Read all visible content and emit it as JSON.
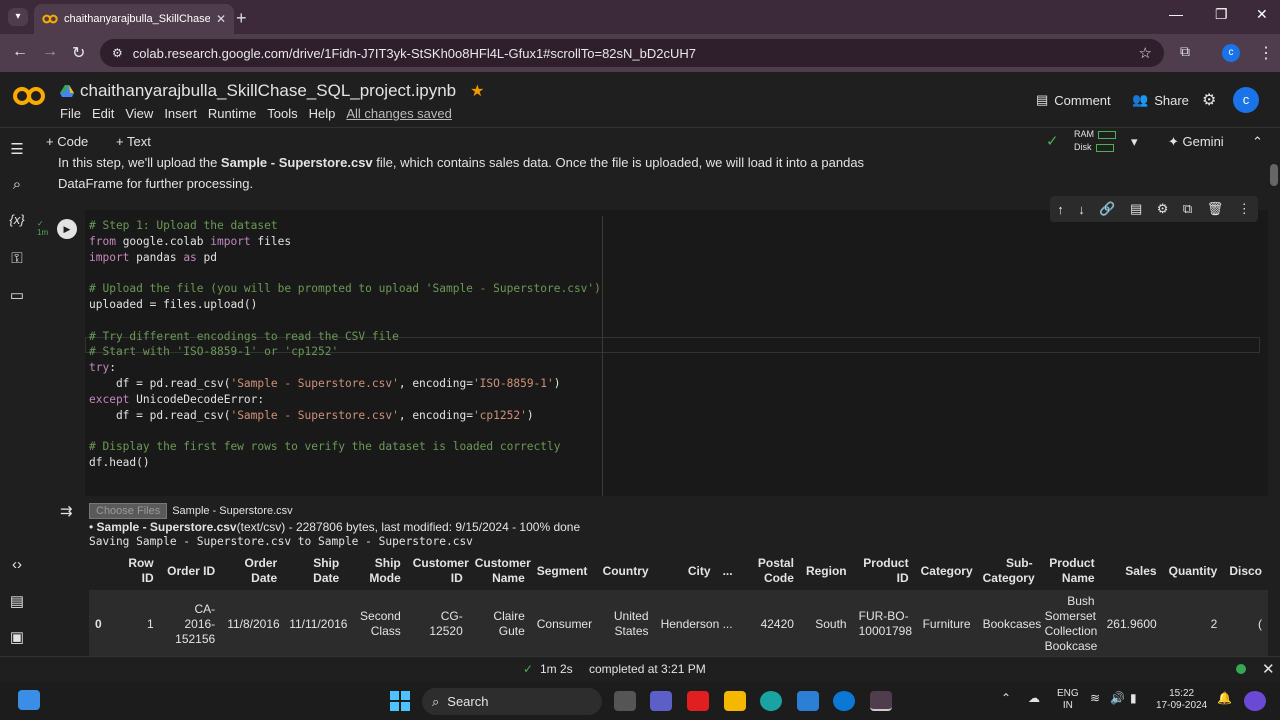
{
  "browser": {
    "tab_title": "chaithanyarajbulla_SkillChase_S",
    "url": "colab.research.google.com/drive/1Fidn-J7IT3yk-StSKh0o8HFl4L-Gfux1#scrollTo=82sN_bD2cUH7",
    "profile_initial": "c"
  },
  "colab": {
    "notebook_title": "chaithanyarajbulla_SkillChase_SQL_project.ipynb",
    "menu": [
      "File",
      "Edit",
      "View",
      "Insert",
      "Runtime",
      "Tools",
      "Help"
    ],
    "saved_status": "All changes saved",
    "comment_label": "Comment",
    "share_label": "Share",
    "avatar_initial": "c",
    "add_code": "+ Code",
    "add_text": "+ Text",
    "ram_label": "RAM",
    "disk_label": "Disk",
    "gemini_label": "Gemini"
  },
  "markdown": {
    "pre": "In this step, we'll upload the ",
    "bold": "Sample - Superstore.csv",
    "post": " file, which contains sales data. Once the file is uploaded, we will load it into a pandas DataFrame for further processing."
  },
  "cell": {
    "exec_time": "1m",
    "code_lines": [
      "# Step 1: Upload the dataset",
      "from google.colab import files",
      "import pandas as pd",
      "",
      "# Upload the file (you will be prompted to upload 'Sample - Superstore.csv')",
      "uploaded = files.upload()",
      "",
      "# Try different encodings to read the CSV file",
      "# Start with 'ISO-8859-1' or 'cp1252'",
      "try:",
      "    df = pd.read_csv('Sample - Superstore.csv', encoding='ISO-8859-1')",
      "except UnicodeDecodeError:",
      "    df = pd.read_csv('Sample - Superstore.csv', encoding='cp1252')",
      "",
      "# Display the first few rows to verify the dataset is loaded correctly",
      "df.head()"
    ]
  },
  "output": {
    "choose_files": "Choose Files",
    "chosen_file": "Sample - Superstore.csv",
    "file_name": "Sample - Superstore.csv",
    "file_meta": "(text/csv) - 2287806 bytes, last modified: 9/15/2024 - 100% done",
    "saving_line": "Saving Sample - Superstore.csv to Sample - Superstore.csv",
    "columns": [
      "",
      "Row ID",
      "Order ID",
      "Order Date",
      "Ship Date",
      "Ship Mode",
      "Customer ID",
      "Customer Name",
      "Segment",
      "Country",
      "City",
      "...",
      "Postal Code",
      "Region",
      "Product ID",
      "Category",
      "Sub-Category",
      "Product Name",
      "Sales",
      "Quantity",
      "Disco"
    ],
    "rows": [
      [
        "0",
        "1",
        "CA-2016-152156",
        "11/8/2016",
        "11/11/2016",
        "Second Class",
        "CG-12520",
        "Claire Gute",
        "Consumer",
        "United States",
        "Henderson",
        "...",
        "42420",
        "South",
        "FUR-BO-10001798",
        "Furniture",
        "Bookcases",
        "Bush Somerset Collection Bookcase",
        "261.9600",
        "2",
        "("
      ]
    ]
  },
  "status": {
    "duration": "1m 2s",
    "completed": "completed at 3:21 PM"
  },
  "taskbar": {
    "search_label": "Search",
    "lang_top": "ENG",
    "lang_bottom": "IN",
    "time": "15:22",
    "date": "17-09-2024"
  }
}
